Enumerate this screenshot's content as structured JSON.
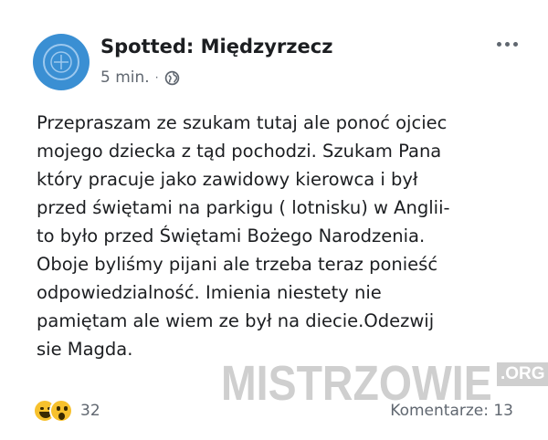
{
  "post": {
    "page_name": "Spotted: Międzyrzecz",
    "timestamp": "5 min.",
    "separator": "·",
    "privacy_icon": "globe-icon",
    "body_lines": [
      "Przepraszam ze szukam tutaj ale ponoć ojciec",
      "mojego dziecka z tąd pochodzi. Szukam Pana",
      "który pracuje jako zawidowy kierowca i był",
      "przed świętami na parkigu ( lotnisku) w Anglii-",
      "to było przed Świętami Bożego Narodzenia.",
      "Oboje byliśmy pijani ale trzeba teraz ponieść",
      "odpowiedzialność. Imienia niestety  nie",
      "pamiętam ale wiem ze był na diecie.Odezwij",
      "sie  Magda."
    ],
    "reactions": {
      "icons": [
        "haha-icon",
        "wow-icon"
      ],
      "count": "32"
    },
    "comments_label": "Komentarze: 13"
  },
  "watermark": {
    "main": "MISTRZOWIE",
    "suffix": ".ORG"
  },
  "colors": {
    "avatar": "#3a8fd3",
    "text": "#1c1e21",
    "secondary": "#606770",
    "reaction": "#f7c12d"
  }
}
